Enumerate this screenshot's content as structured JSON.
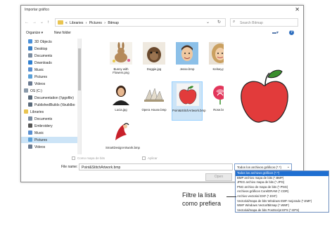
{
  "dialog": {
    "title": "Importar gráfico",
    "close_glyph": "✕"
  },
  "address": {
    "crumbs": [
      "«",
      "Libraries",
      "›",
      "Pictures",
      "›",
      "Bitmap"
    ],
    "search_placeholder": "Search Bitmap"
  },
  "toolbar": {
    "organize_label": "Organize ▾",
    "new_folder_label": "New folder"
  },
  "nav": {
    "items": [
      {
        "label": "3D Objects",
        "icon": "3d-objects-icon",
        "color": "#4a90d9"
      },
      {
        "label": "Desktop",
        "icon": "desktop-icon",
        "color": "#3b7fc4"
      },
      {
        "label": "Documents",
        "icon": "documents-icon",
        "color": "#7a8ca0"
      },
      {
        "label": "Downloads",
        "icon": "downloads-icon",
        "color": "#2f7fd0"
      },
      {
        "label": "Music",
        "icon": "music-icon",
        "color": "#5a8fd0"
      },
      {
        "label": "Pictures",
        "icon": "pictures-icon",
        "color": "#5aa0d8"
      },
      {
        "label": "Videos",
        "icon": "videos-icon",
        "color": "#6a7a90"
      },
      {
        "label": "OS (C:)",
        "icon": "drive-icon",
        "color": "#8a9aaa"
      },
      {
        "label": "Documentation (\\\\pgofile)",
        "icon": "network-drive-icon",
        "color": "#5a6a7a"
      },
      {
        "label": "PublishedBuilds (\\\\buildbo",
        "icon": "network-drive-icon",
        "color": "#5a6a7a"
      },
      {
        "label": "Libraries",
        "icon": "libraries-icon",
        "color": "#e9c450"
      },
      {
        "label": "Documents",
        "icon": "documents-icon",
        "color": "#7a8ca0"
      },
      {
        "label": "Embroidery",
        "icon": "embroidery-icon",
        "color": "#555555"
      },
      {
        "label": "Music",
        "icon": "music-icon",
        "color": "#5a8fd0"
      },
      {
        "label": "Pictures",
        "icon": "pictures-icon",
        "color": "#5aa0d8"
      },
      {
        "label": "Videos",
        "icon": "videos-icon",
        "color": "#6a7a90"
      }
    ]
  },
  "files": [
    {
      "name": "Bunny with Flowers.png",
      "kind": "bunny"
    },
    {
      "name": "Doggie.jpg",
      "kind": "dog"
    },
    {
      "name": "Jesse.bmp",
      "kind": "boy"
    },
    {
      "name": "Kelsey.png",
      "kind": "girl"
    },
    {
      "name": "Lucia.jpg",
      "kind": "woman"
    },
    {
      "name": "Opera House.bmp",
      "kind": "opera"
    },
    {
      "name": "Point&StitchArtwork.bmp",
      "kind": "apple",
      "selected": true
    },
    {
      "name": "Rose.bmp",
      "kind": "rose"
    },
    {
      "name": "SmartDesignArtwork.bmp",
      "kind": "smartdesign"
    }
  ],
  "options": {
    "as_bitmap": "Como mapa de bits",
    "apply": "Aplicar"
  },
  "filename": {
    "label": "File name:",
    "value": "Point&StitchArtwork.bmp"
  },
  "filetype": {
    "selected": "Todos los archivos gráficos (*.*)",
    "options": [
      "Todos los archivos gráficos (*.*)",
      "BMP archivo mapa de bits (*.BMP)",
      "JPEG archivo mapa de bits (*.JPG)",
      "PNG archivo de mapa de bits (*.PNG)",
      "Archivos gráficos CorelDRAW (*.CDR)",
      "Archivo vectorial DXF (*.DXF)",
      "Vectorial/mapa de bits Windows EMF mejorado (*.EMF)",
      "WMF Windows Vector/Bitmap (*.WMF)",
      "Vectorial/mapa de bits PostScript EPS (*.EPS)"
    ]
  },
  "buttons": {
    "open_label": "Open"
  },
  "callout": {
    "line1": "Filtre la lista",
    "line2": "como prefiera"
  },
  "colors": {
    "selection": "#cce4f7",
    "dropdown_highlight": "#1f6fd1",
    "apple_red": "#e23b3b",
    "leaf_green": "#3a8f2e"
  }
}
